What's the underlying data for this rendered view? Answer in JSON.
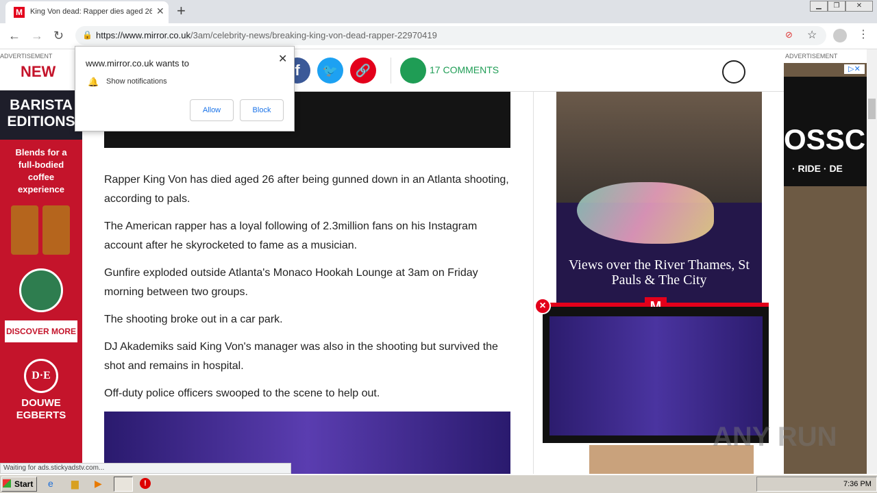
{
  "browser": {
    "tab_title": "King Von dead: Rapper dies aged 26",
    "favicon_letter": "M",
    "new_tab": "+",
    "url_host": "https://www.mirror.co.uk",
    "url_path": "/3am/celebrity-news/breaking-king-von-dead-rapper-22970419",
    "status_text": "Waiting for ads.stickyadstv.com..."
  },
  "notification": {
    "site": "www.mirror.co.uk wants to",
    "item": "Show notifications",
    "allow": "Allow",
    "block": "Block"
  },
  "share": {
    "comments_count": "17",
    "comments_label": "COMMENTS"
  },
  "ads": {
    "label": "ADVERTISEMENT",
    "left_new": "NEW",
    "left_title": "BARISTA EDITIONS",
    "left_tagline": "Blends for a full-bodied coffee experience",
    "left_cta": "DISCOVER MORE",
    "left_brand_logo": "D·E",
    "left_brand": "DOUWE EGBERTS",
    "right_text1": "OSSC",
    "right_text2": "· RIDE · DE",
    "middle_caption": "Views over the River Thames, St Pauls & The City"
  },
  "article": {
    "paragraphs": [
      "Rapper King Von has died aged 26 after being gunned down in an Atlanta shooting, according to pals.",
      "The American rapper has a loyal following of 2.3million fans on his Instagram account after he skyrocketed to fame as a musician.",
      "Gunfire exploded outside Atlanta's Monaco Hookah Lounge at 3am on Friday morning between two groups.",
      "The shooting broke out in a car park.",
      "DJ Akademiks said King Von's manager was also in the shooting but survived the shot and remains in hospital.",
      "Off-duty police officers swooped to the scene to help out."
    ]
  },
  "video": {
    "badge": "M",
    "close": "×"
  },
  "watermark": "ANY RUN",
  "taskbar": {
    "start": "Start",
    "time": "7:36 PM"
  },
  "colors": {
    "mirror_red": "#e3001b",
    "facebook": "#3b5998",
    "twitter": "#1da1f2",
    "comments_green": "#1f9d55"
  }
}
